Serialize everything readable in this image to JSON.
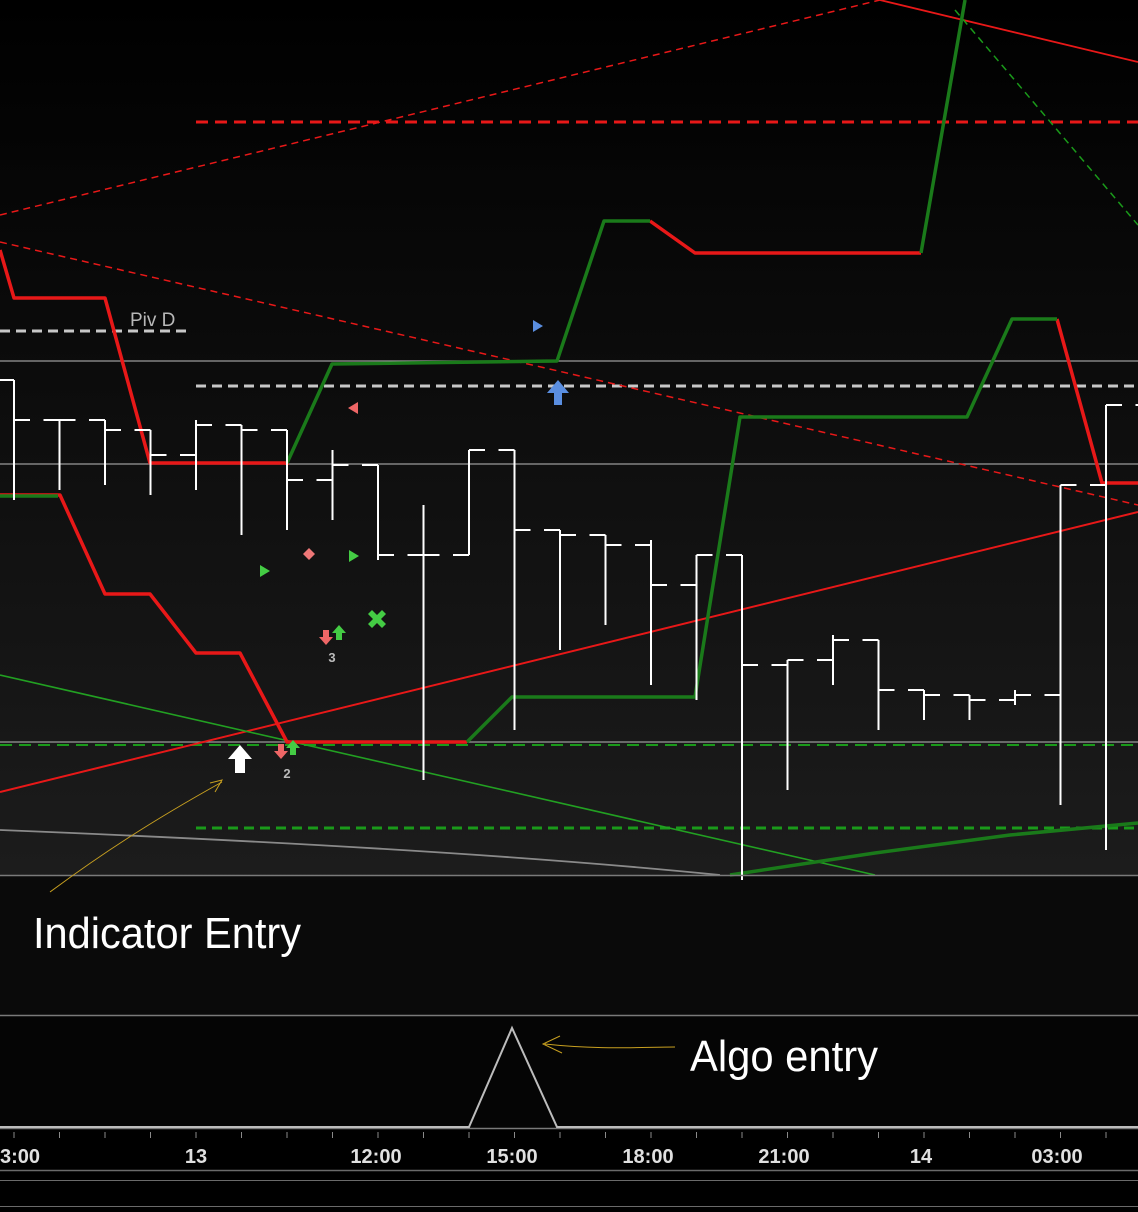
{
  "chart_data": {
    "type": "ohlc",
    "title": "",
    "annotations": {
      "pivot_label": "Piv D",
      "indicator_entry": "Indicator Entry",
      "algo_entry": "Algo entry",
      "signal_count_a": "3",
      "signal_count_b": "2"
    },
    "x_ticks": [
      "3:00",
      "13",
      "12:00",
      "15:00",
      "18:00",
      "21:00",
      "14",
      "03:00"
    ],
    "colors": {
      "bar": "#ffffff",
      "red_line": "#e81818",
      "green_line": "#1a7a1a",
      "annotation_arrow": "#c8a020",
      "pivot": "#c8c8c8"
    },
    "ohlc_bars": [
      [
        505,
        445,
        385,
        465
      ],
      [
        465,
        450,
        395,
        465
      ],
      [
        465,
        455,
        400,
        455
      ],
      [
        455,
        445,
        390,
        430
      ],
      [
        430,
        465,
        395,
        460
      ],
      [
        460,
        440,
        350,
        455
      ],
      [
        455,
        405,
        355,
        405
      ],
      [
        405,
        435,
        365,
        420
      ],
      [
        420,
        410,
        325,
        330
      ],
      [
        330,
        380,
        105,
        330
      ],
      [
        330,
        355,
        335,
        435
      ],
      [
        435,
        345,
        155,
        355
      ],
      [
        355,
        340,
        235,
        350
      ],
      [
        350,
        260,
        265,
        340
      ],
      [
        340,
        345,
        200,
        300
      ],
      [
        300,
        325,
        185,
        330
      ],
      [
        330,
        220,
        5,
        220
      ],
      [
        220,
        225,
        95,
        225
      ],
      [
        225,
        250,
        200,
        245
      ],
      [
        245,
        210,
        155,
        195
      ],
      [
        195,
        180,
        165,
        190
      ],
      [
        190,
        165,
        170,
        185
      ],
      [
        185,
        195,
        180,
        190
      ],
      [
        190,
        245,
        80,
        400
      ],
      [
        400,
        420,
        35,
        480
      ],
      [
        480,
        415,
        170,
        425
      ],
      [
        425,
        360,
        155,
        360
      ],
      [
        360,
        285,
        140,
        305
      ],
      [
        305,
        250,
        170,
        230
      ],
      [
        230,
        190,
        195,
        220
      ],
      [
        220,
        220,
        190,
        220
      ]
    ]
  }
}
